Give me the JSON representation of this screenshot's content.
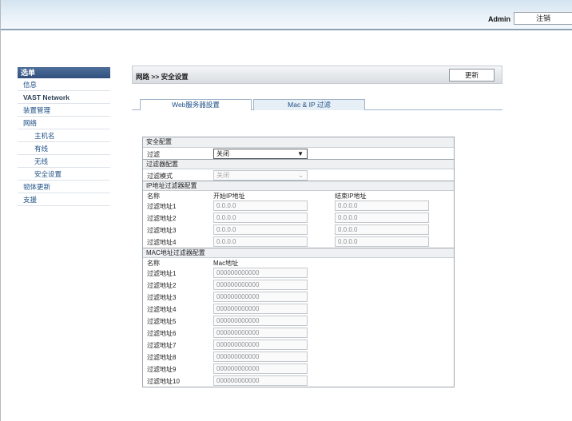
{
  "header": {
    "user": "Admin",
    "logout": "注销"
  },
  "sidebar": {
    "title": "选单",
    "items": [
      {
        "label": "信息"
      },
      {
        "label": "VAST Network"
      },
      {
        "label": "装置管理"
      },
      {
        "label": "网络"
      },
      {
        "label": "主机名"
      },
      {
        "label": "有线"
      },
      {
        "label": "无线"
      },
      {
        "label": "安全设置"
      },
      {
        "label": "韧体更新"
      },
      {
        "label": "支援"
      }
    ]
  },
  "main": {
    "breadcrumb": "网路 >> 安全设置",
    "update_button": "更新",
    "tabs": [
      {
        "label": "Web服务器設置"
      },
      {
        "label": "Mac & IP 过滤"
      }
    ]
  },
  "security": {
    "section_title": "安全配置",
    "filter_label": "过滤",
    "filter_value": "关闭"
  },
  "filter_config": {
    "section_title": "过滤器配置",
    "mode_label": "过滤模式",
    "mode_value": "关闭"
  },
  "ip_filter": {
    "section_title": "IP地址过滤器配置",
    "col_name": "名称",
    "col_start": "开始IP地址",
    "col_end": "结束IP地址",
    "rows": [
      {
        "name": "过滤地址1",
        "start": "0.0.0.0",
        "end": "0.0.0.0"
      },
      {
        "name": "过滤地址2",
        "start": "0.0.0.0",
        "end": "0.0.0.0"
      },
      {
        "name": "过滤地址3",
        "start": "0.0.0.0",
        "end": "0.0.0.0"
      },
      {
        "name": "过滤地址4",
        "start": "0.0.0.0",
        "end": "0.0.0.0"
      }
    ]
  },
  "mac_filter": {
    "section_title": "MAC地址过滤器配置",
    "col_name": "名称",
    "col_mac": "Mac地址",
    "rows": [
      {
        "name": "过滤地址1",
        "mac": "000000000000"
      },
      {
        "name": "过滤地址2",
        "mac": "000000000000"
      },
      {
        "name": "过滤地址3",
        "mac": "000000000000"
      },
      {
        "name": "过滤地址4",
        "mac": "000000000000"
      },
      {
        "name": "过滤地址5",
        "mac": "000000000000"
      },
      {
        "name": "过滤地址6",
        "mac": "000000000000"
      },
      {
        "name": "过滤地址7",
        "mac": "000000000000"
      },
      {
        "name": "过滤地址8",
        "mac": "000000000000"
      },
      {
        "name": "过滤地址9",
        "mac": "000000000000"
      },
      {
        "name": "过滤地址10",
        "mac": "000000000000"
      }
    ]
  }
}
